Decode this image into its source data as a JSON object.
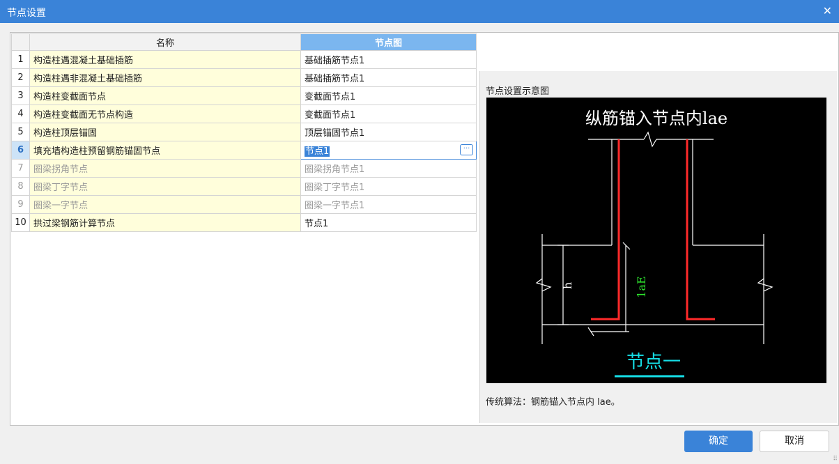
{
  "window": {
    "title": "节点设置",
    "close_glyph": "✕"
  },
  "table": {
    "headers": {
      "name": "名称",
      "node": "节点图"
    },
    "rows": [
      {
        "idx": "1",
        "name": "构造柱遇混凝土基础插筋",
        "node": "基础插筋节点1",
        "state": "normal"
      },
      {
        "idx": "2",
        "name": "构造柱遇非混凝土基础插筋",
        "node": "基础插筋节点1",
        "state": "normal"
      },
      {
        "idx": "3",
        "name": "构造柱变截面节点",
        "node": "变截面节点1",
        "state": "normal"
      },
      {
        "idx": "4",
        "name": "构造柱变截面无节点构造",
        "node": "变截面节点1",
        "state": "normal"
      },
      {
        "idx": "5",
        "name": "构造柱顶层锚固",
        "node": "顶层锚固节点1",
        "state": "normal"
      },
      {
        "idx": "6",
        "name": "填充墙构造柱预留钢筋锚固节点",
        "node": "节点1",
        "state": "selected"
      },
      {
        "idx": "7",
        "name": "圈梁拐角节点",
        "node": "圈梁拐角节点1",
        "state": "disabled"
      },
      {
        "idx": "8",
        "name": "圈梁丁字节点",
        "node": "圈梁丁字节点1",
        "state": "disabled"
      },
      {
        "idx": "9",
        "name": "圈梁一字节点",
        "node": "圈梁一字节点1",
        "state": "disabled"
      },
      {
        "idx": "10",
        "name": "拱过梁钢筋计算节点",
        "node": "节点1",
        "state": "normal"
      }
    ],
    "ellipsis_glyph": "···"
  },
  "preview": {
    "label": "节点设置示意图",
    "diagram_title": "纵筋锚入节点内lae",
    "dim_h": "h",
    "dim_lae": "1aE",
    "caption": "节点一",
    "colors": {
      "rebar": "#ff2a2a",
      "outline": "#ffffff",
      "lae": "#2ee62e",
      "caption": "#16e0e8"
    }
  },
  "description": "传统算法：钢筋锚入节点内 lae。",
  "buttons": {
    "ok": "确定",
    "cancel": "取消"
  },
  "accent": "#3a83d8"
}
